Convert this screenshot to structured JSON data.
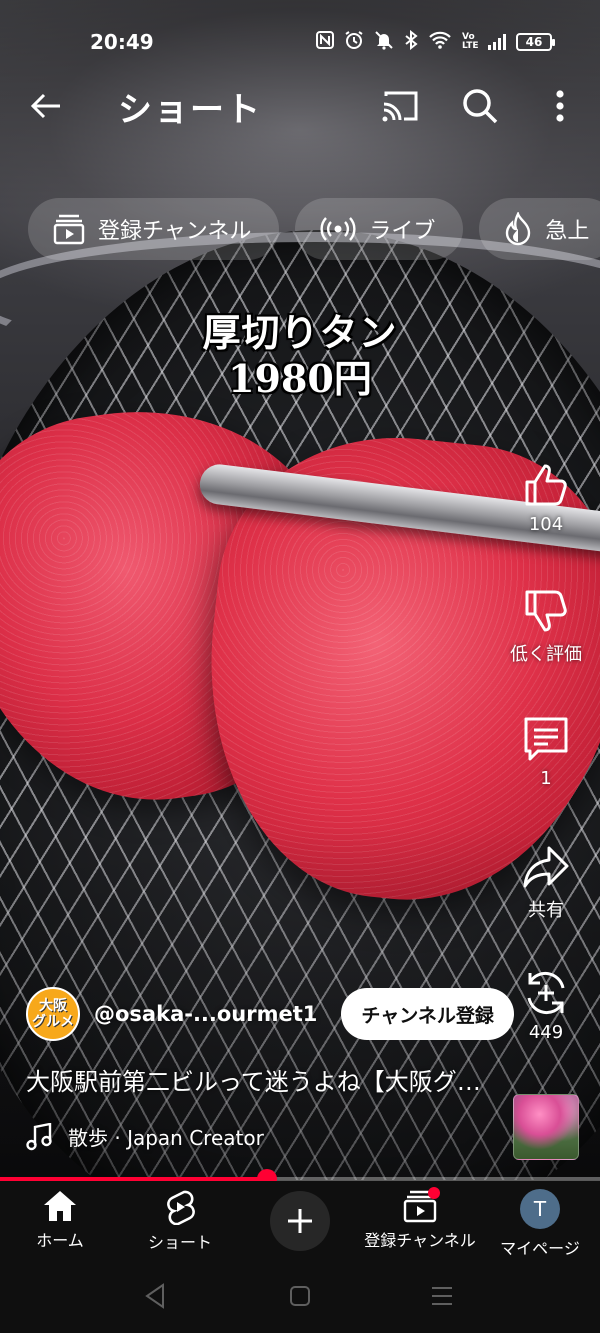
{
  "status_bar": {
    "time": "20:49",
    "battery": "46",
    "volte": "Vo LTE"
  },
  "header": {
    "title": "ショート"
  },
  "chips": [
    {
      "label": "登録チャンネル",
      "icon": "subscriptions-icon"
    },
    {
      "label": "ライブ",
      "icon": "live-icon"
    },
    {
      "label": "急上",
      "icon": "trending-icon"
    }
  ],
  "video": {
    "caption_line1": "厚切りタン",
    "caption_line2": "1980円",
    "progress_fraction": 0.445
  },
  "actions": {
    "like_count": "104",
    "dislike_label": "低く評価",
    "comment_count": "1",
    "share_label": "共有",
    "remix_count": "449"
  },
  "channel": {
    "avatar_text_1": "大阪",
    "avatar_text_2": "グルメ",
    "handle": "@osaka-...ourmet1",
    "subscribe_label": "チャンネル登録"
  },
  "title": "大阪駅前第二ビルって迷うよね【大阪グルメ】",
  "music": "散歩 · Japan Creator",
  "bottom_nav": {
    "home": "ホーム",
    "shorts": "ショート",
    "subscriptions": "登録チャンネル",
    "you": "マイページ",
    "you_initial": "T"
  },
  "colors": {
    "accent_red": "#ff0033",
    "nav_bg": "#0f0f0f",
    "subscribe_bg": "#ffffff"
  }
}
